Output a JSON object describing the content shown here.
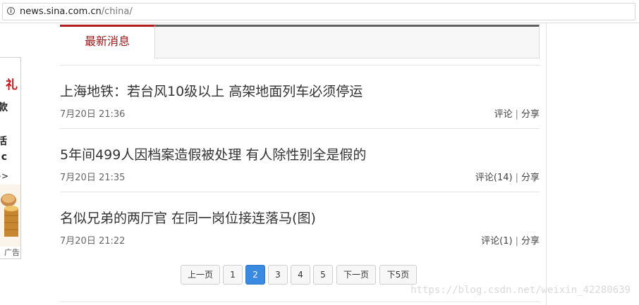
{
  "browser": {
    "url_host": "news.sina.com.cn",
    "url_path": "/china/",
    "info_icon": "i"
  },
  "ad": {
    "line1": "礼",
    "line2": "款",
    "line3": "活",
    "line4": "c",
    "line5": ">>",
    "label": "广告"
  },
  "tabs": {
    "active_label": "最新消息"
  },
  "news": [
    {
      "title": "上海地铁：若台风10级以上 高架地面列车必须停运",
      "time": "7月20日 21:36",
      "comment": "评论",
      "share": "分享"
    },
    {
      "title": "5年间499人因档案造假被处理 有人除性别全是假的",
      "time": "7月20日 21:35",
      "comment": "评论(14)",
      "share": "分享"
    },
    {
      "title": "名似兄弟的两厅官 在同一岗位接连落马(图)",
      "time": "7月20日 21:22",
      "comment": "评论(1)",
      "share": "分享"
    }
  ],
  "pagination": {
    "prev": "上一页",
    "pages": [
      "1",
      "2",
      "3",
      "4",
      "5"
    ],
    "current": "2",
    "next": "下一页",
    "next5": "下5页"
  },
  "watermark": "https://blog.csdn.net/weixin_42280639"
}
